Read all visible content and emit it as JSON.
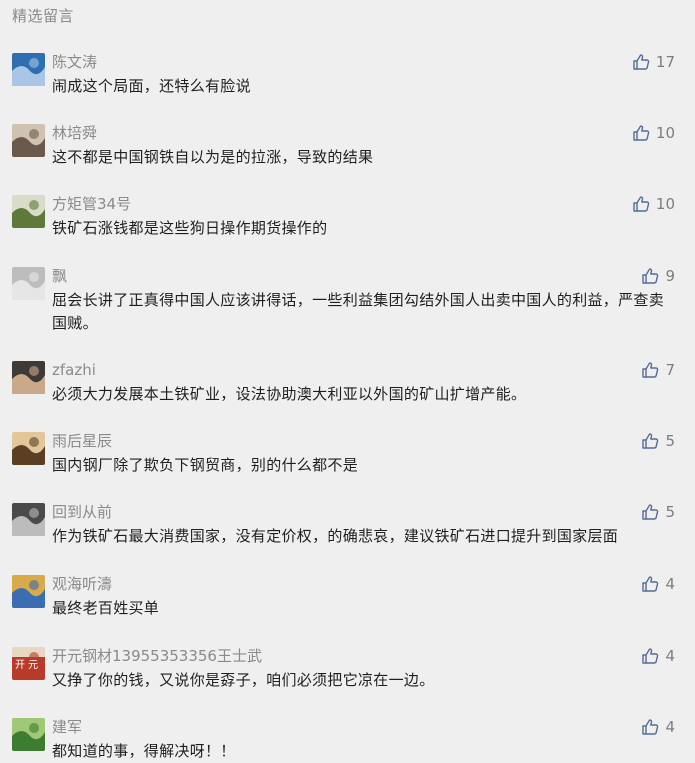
{
  "section_title": "精选留言",
  "accent_color": "#576b95",
  "comments": [
    {
      "nickname": "陈文涛",
      "content": "闹成这个局面，还特么有脸说",
      "likes": "17",
      "avatar_colors": [
        "#a9c6e6",
        "#2d6fb0"
      ]
    },
    {
      "nickname": "林培舜",
      "content": "这不都是中国钢铁自以为是的拉涨，导致的结果",
      "likes": "10",
      "avatar_colors": [
        "#6b5a4c",
        "#cfc2b0"
      ]
    },
    {
      "nickname": "方矩管34号",
      "content": "铁矿石涨钱都是这些狗日操作期货操作的",
      "likes": "10",
      "avatar_colors": [
        "#5d7a3a",
        "#d8dcc8"
      ]
    },
    {
      "nickname": "飘",
      "content": "屈会长讲了正真得中国人应该讲得话，一些利益集团勾结外国人出卖中国人的利益，严查卖国贼。",
      "likes": "9",
      "avatar_colors": [
        "#e6e6e6",
        "#bdbdbd"
      ]
    },
    {
      "nickname": "zfazhi",
      "content": "必须大力发展本土铁矿业，设法协助澳大利亚以外国的矿山扩增产能。",
      "likes": "7",
      "avatar_colors": [
        "#c9a98a",
        "#3e3a38"
      ]
    },
    {
      "nickname": "雨后星辰",
      "content": "国内钢厂除了欺负下钢贸商，别的什么都不是",
      "likes": "5",
      "avatar_colors": [
        "#5b3f25",
        "#e3c79a"
      ]
    },
    {
      "nickname": "回到从前",
      "content": "作为铁矿石最大消费国家，没有定价权，的确悲哀，建议铁矿石进口提升到国家层面",
      "likes": "5",
      "avatar_colors": [
        "#bcbcbc",
        "#4a4a4a"
      ]
    },
    {
      "nickname": "观海听濤",
      "content": "最终老百姓买单",
      "likes": "4",
      "avatar_colors": [
        "#3b6db3",
        "#d9a94a"
      ]
    },
    {
      "nickname": "开元钢材13955353356王士武",
      "content": "又挣了你的钱，又说你是孬子，咱们必须把它凉在一边。",
      "likes": "4",
      "avatar_colors": [
        "#b83a2a",
        "#e8d7c4"
      ],
      "avatar_text": "开 元"
    },
    {
      "nickname": "建军",
      "content": "都知道的事，得解决呀！！",
      "likes": "4",
      "avatar_colors": [
        "#3c7d2f",
        "#9fc977"
      ]
    }
  ]
}
